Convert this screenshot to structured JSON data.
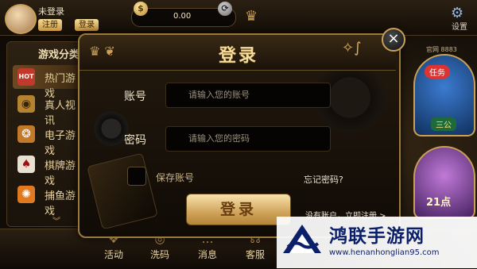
{
  "header": {
    "username": "未登录",
    "register_label": "注册",
    "login_label": "登录",
    "balance": "0.00",
    "settings_label": "设置"
  },
  "sidebar": {
    "title": "游戏分类",
    "items": [
      {
        "label": "热门游戏",
        "icon": "hot-icon"
      },
      {
        "label": "真人视讯",
        "icon": "live-icon"
      },
      {
        "label": "电子游戏",
        "icon": "slot-icon"
      },
      {
        "label": "棋牌游戏",
        "icon": "cards-icon"
      },
      {
        "label": "捕鱼游戏",
        "icon": "fish-icon"
      }
    ],
    "hot_badge": "HOT"
  },
  "promo": {
    "task_label": "任务",
    "sanguo_label": "三公",
    "pt_label": "21点",
    "corner_text": "官网 8883"
  },
  "bottom_nav": [
    {
      "label": "活动",
      "icon": "gift-icon"
    },
    {
      "label": "洗码",
      "icon": "coins-icon"
    },
    {
      "label": "消息",
      "icon": "chat-icon"
    },
    {
      "label": "客服",
      "icon": "headset-icon"
    }
  ],
  "modal": {
    "title": "登录",
    "account_label": "账号",
    "account_placeholder": "请输入您的账号",
    "password_label": "密码",
    "password_placeholder": "请输入您的密码",
    "remember_label": "保存账号",
    "forgot_label": "忘记密码?",
    "submit_label": "登录",
    "no_account_text": "没有账户，立即注册 >",
    "close_icon": "close-icon"
  },
  "watermark": {
    "title": "鸿联手游网",
    "url": "www.henanhonglian95.com"
  },
  "colors": {
    "accent_gold": "#c9a056",
    "button_gold": "#f7e2ad",
    "background": "#16100a",
    "watermark_blue": "#0b1f6a"
  }
}
